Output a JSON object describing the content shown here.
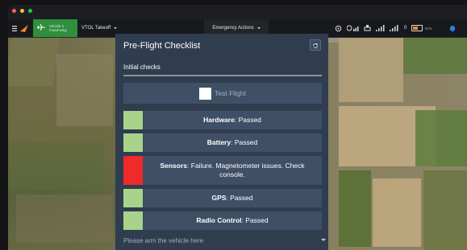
{
  "window_controls": {
    "close_color": "#ff5f57",
    "minimize_color": "#febc2e",
    "maximize_color": "#28c840"
  },
  "toolbar": {
    "menu_icon": "hamburger-icon",
    "logo_icon": "app-logo",
    "vehicle": {
      "line1": "Vehicle 1",
      "line2": "Fixed-wing",
      "icon": "plane-icon"
    },
    "flight_mode": "VTOL Takeoff",
    "center_label": "Emergency Actions",
    "indicators": {
      "link_count": "0",
      "battery_label": "50%"
    }
  },
  "panel": {
    "title": "Pre-Flight Checklist",
    "refresh_icon": "refresh-icon",
    "section_label": "Initial checks",
    "test_flight_label": "Test Flight",
    "checks": [
      {
        "name": "Hardware",
        "status": "Passed",
        "color": "#a8d38a"
      },
      {
        "name": "Battery",
        "status": "Passed",
        "color": "#a8d38a"
      },
      {
        "name": "Sensors",
        "status": "Failure. Magnetometer issues. Check console.",
        "color": "#ee2a2a"
      },
      {
        "name": "GPS",
        "status": "Passed",
        "color": "#a8d38a"
      },
      {
        "name": "Radio Control",
        "status": "Passed",
        "color": "#a8d38a"
      }
    ],
    "footer_label": "Please arm the vehicle here"
  }
}
